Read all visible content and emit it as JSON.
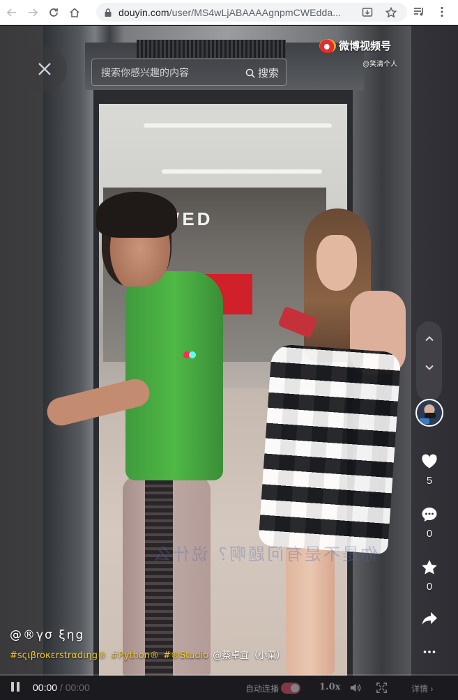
{
  "browser": {
    "url_host": "douyin.com",
    "url_path": "/user/MS4wLjABAAAAgnpmCWEdda..."
  },
  "video": {
    "watermark_title": "微博视频号",
    "watermark_sub": "@笑清个人",
    "store_sign": "VED",
    "subtitle": "你是不是有问题啊？说什么"
  },
  "search": {
    "placeholder": "搜索你感兴趣的内容",
    "button_label": "搜索"
  },
  "actions": {
    "likes": "5",
    "comments": "0",
    "favorites": "0"
  },
  "post": {
    "author": "@®γσ ξηg",
    "tags": [
      "#sςιβroκεrstrαdιηg®",
      "#Python®",
      "#®Studio"
    ],
    "mention": "@蔡卓宜（小菜）"
  },
  "controls": {
    "current_time": "00:00",
    "separator": "/",
    "duration": "00:00",
    "autoplay_label": "自动连播",
    "speed": "1.0x",
    "details_label": "详情"
  },
  "colors": {
    "tag_yellow": "#face15",
    "brand_red": "#fe2c55",
    "brand_cyan": "#25f4ee"
  }
}
